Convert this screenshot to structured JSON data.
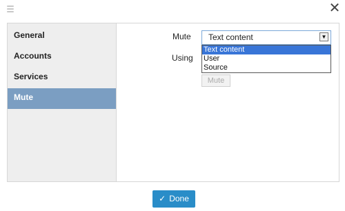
{
  "sidebar": {
    "items": [
      {
        "label": "General"
      },
      {
        "label": "Accounts"
      },
      {
        "label": "Services"
      },
      {
        "label": "Mute",
        "active": true
      }
    ]
  },
  "form": {
    "mute_label": "Mute",
    "using_label": "Using",
    "mute_select_value": "Text content",
    "mute_options": [
      "Text content",
      "User",
      "Source"
    ],
    "mute_button_label": "Mute"
  },
  "footer": {
    "done_label": "Done"
  },
  "icons": {
    "close": "close-icon",
    "grip": "drag-grip-icon",
    "check": "check-icon",
    "dropdown": "chevron-down-icon"
  },
  "colors": {
    "active_item": "#7b9ec2",
    "primary_button": "#2a8dc8",
    "option_highlight": "#3875d7"
  }
}
